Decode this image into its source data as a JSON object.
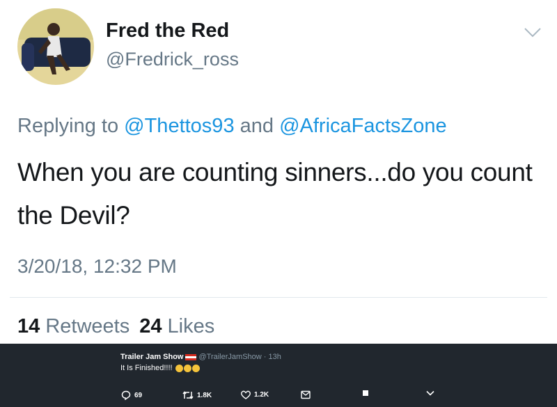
{
  "user": {
    "name": "Fred the Red",
    "handle": "@Fredrick_ross"
  },
  "reply": {
    "prefix": "Replying to",
    "mention1": "@Thettos93",
    "conjunction": "and",
    "mention2": "@AfricaFactsZone"
  },
  "tweet": {
    "text": "When you are counting sinners...do you count the Devil?",
    "timestamp": "3/20/18, 12:32 PM"
  },
  "stats": {
    "retweets_count": "14",
    "retweets_label": "Retweets",
    "likes_count": "24",
    "likes_label": "Likes"
  },
  "overlay_tweet": {
    "name": "Trailer Jam Show",
    "handle": "@TrailerJamShow",
    "time": "· 13h",
    "text": "It Is Finished!!!!",
    "replies": "69",
    "retweets": "1.8K",
    "likes": "1.2K"
  },
  "icons": [
    "caret-down-icon",
    "reply-icon",
    "retweet-icon",
    "heart-icon",
    "envelope-icon",
    "stop-icon",
    "chevron-down-icon"
  ],
  "colors": {
    "link": "#1b95e0",
    "muted": "#657786",
    "text": "#14171a",
    "overlay_bg": "#21272e"
  }
}
